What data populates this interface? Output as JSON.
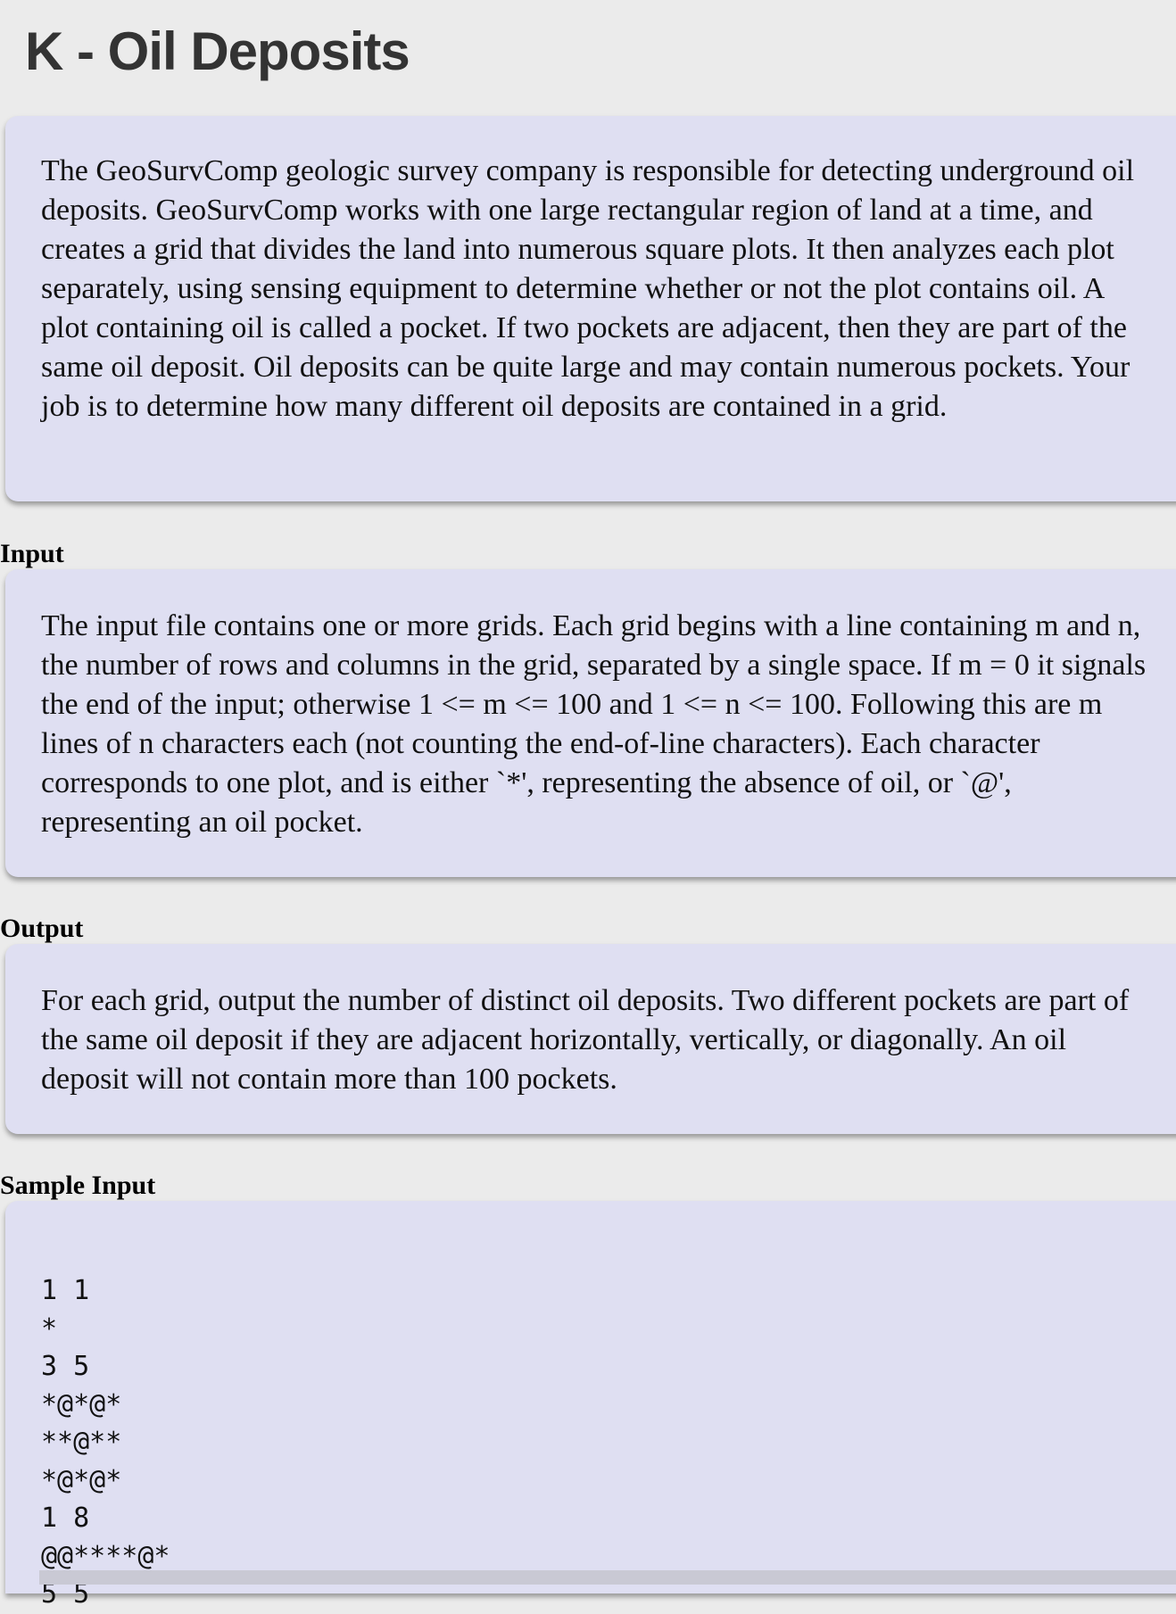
{
  "page": {
    "title": "K - Oil Deposits"
  },
  "description": {
    "text": "The GeoSurvComp geologic survey company is responsible for detecting underground oil deposits. GeoSurvComp works with one large rectangular region of land at a time, and creates a grid that divides the land into numerous square plots. It then analyzes each plot separately, using sensing equipment to determine whether or not the plot contains oil. A plot containing oil is called a pocket. If two pockets are adjacent, then they are part of the same oil deposit. Oil deposits can be quite large and may contain numerous pockets. Your job is to determine how many different oil deposits are contained in a grid."
  },
  "input": {
    "heading": "Input",
    "text": "The input file contains one or more grids. Each grid begins with a line containing m and n, the number of rows and columns in the grid, separated by a single space. If m = 0 it signals the end of the input; otherwise 1 <= m <= 100 and 1 <= n <= 100. Following this are m lines of n characters each (not counting the end-of-line characters). Each character corresponds to one plot, and is either `*', representing the absence of oil, or `@', representing an oil pocket."
  },
  "output": {
    "heading": "Output",
    "text": "For each grid, output the number of distinct oil deposits. Two different pockets are part of the same oil deposit if they are adjacent horizontally, vertically, or diagonally. An oil deposit will not contain more than 100 pockets."
  },
  "sample_input": {
    "heading": "Sample Input",
    "code": "1 1\n*\n3 5\n*@*@*\n**@**\n*@*@*\n1 8\n@@****@*\n5 5"
  },
  "colors": {
    "page_background": "#ebebeb",
    "panel_background": "#dfdff2",
    "title_text": "#333333"
  }
}
